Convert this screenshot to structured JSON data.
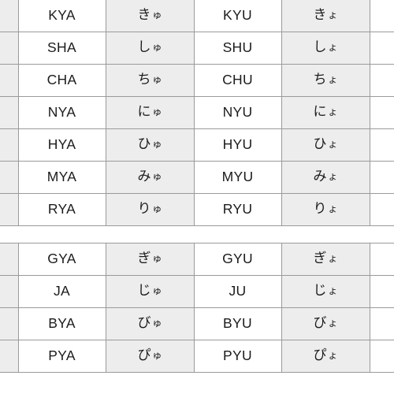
{
  "document": {
    "title": "Japanese Yoon Romaji to Hiragana Chart",
    "colors": {
      "tint_cell": "#ededed",
      "plain_cell": "#ffffff",
      "border": "#9a9a9a",
      "text": "#1b1b1b",
      "page_background": "#ffffff"
    }
  },
  "tables": [
    {
      "name": "unvoiced-yoon-table",
      "columns": [
        "",
        "romaji_ya",
        "kana_yu",
        "romaji_yu",
        "kana_yo",
        ""
      ],
      "rows": [
        {
          "edge_left": "",
          "romaji_a": "KYA",
          "kana_u_main": "き",
          "kana_u_small": "ゅ",
          "romaji_u": "KYU",
          "kana_o_main": "き",
          "kana_o_small": "ょ",
          "edge_right": ""
        },
        {
          "edge_left": "",
          "romaji_a": "SHA",
          "kana_u_main": "し",
          "kana_u_small": "ゅ",
          "romaji_u": "SHU",
          "kana_o_main": "し",
          "kana_o_small": "ょ",
          "edge_right": ""
        },
        {
          "edge_left": "",
          "romaji_a": "CHA",
          "kana_u_main": "ち",
          "kana_u_small": "ゅ",
          "romaji_u": "CHU",
          "kana_o_main": "ち",
          "kana_o_small": "ょ",
          "edge_right": ""
        },
        {
          "edge_left": "",
          "romaji_a": "NYA",
          "kana_u_main": "に",
          "kana_u_small": "ゅ",
          "romaji_u": "NYU",
          "kana_o_main": "に",
          "kana_o_small": "ょ",
          "edge_right": ""
        },
        {
          "edge_left": "",
          "romaji_a": "HYA",
          "kana_u_main": "ひ",
          "kana_u_small": "ゅ",
          "romaji_u": "HYU",
          "kana_o_main": "ひ",
          "kana_o_small": "ょ",
          "edge_right": ""
        },
        {
          "edge_left": "",
          "romaji_a": "MYA",
          "kana_u_main": "み",
          "kana_u_small": "ゅ",
          "romaji_u": "MYU",
          "kana_o_main": "み",
          "kana_o_small": "ょ",
          "edge_right": ""
        },
        {
          "edge_left": "",
          "romaji_a": "RYA",
          "kana_u_main": "り",
          "kana_u_small": "ゅ",
          "romaji_u": "RYU",
          "kana_o_main": "り",
          "kana_o_small": "ょ",
          "edge_right": ""
        }
      ]
    },
    {
      "name": "voiced-yoon-table",
      "columns": [
        "",
        "romaji_ya",
        "kana_yu",
        "romaji_yu",
        "kana_yo",
        ""
      ],
      "rows": [
        {
          "edge_left": "",
          "romaji_a": "GYA",
          "kana_u_main": "ぎ",
          "kana_u_small": "ゅ",
          "romaji_u": "GYU",
          "kana_o_main": "ぎ",
          "kana_o_small": "ょ",
          "edge_right": ""
        },
        {
          "edge_left": "",
          "romaji_a": "JA",
          "kana_u_main": "じ",
          "kana_u_small": "ゅ",
          "romaji_u": "JU",
          "kana_o_main": "じ",
          "kana_o_small": "ょ",
          "edge_right": ""
        },
        {
          "edge_left": "",
          "romaji_a": "BYA",
          "kana_u_main": "び",
          "kana_u_small": "ゅ",
          "romaji_u": "BYU",
          "kana_o_main": "び",
          "kana_o_small": "ょ",
          "edge_right": ""
        },
        {
          "edge_left": "",
          "romaji_a": "PYA",
          "kana_u_main": "ぴ",
          "kana_u_small": "ゅ",
          "romaji_u": "PYU",
          "kana_o_main": "ぴ",
          "kana_o_small": "ょ",
          "edge_right": ""
        }
      ]
    }
  ]
}
